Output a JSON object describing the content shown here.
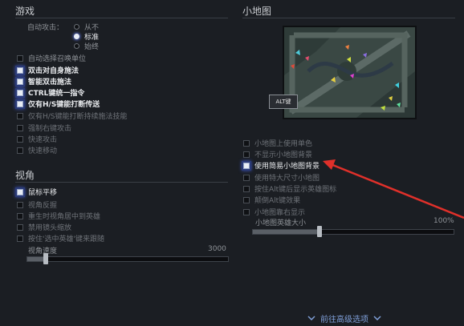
{
  "game": {
    "title": "游戏",
    "autoattack_label": "自动攻击：",
    "autoattack_options": [
      {
        "label": "从不",
        "selected": false
      },
      {
        "label": "标准",
        "selected": true
      },
      {
        "label": "始终",
        "selected": false
      }
    ],
    "options": [
      {
        "label": "自动选择召唤单位",
        "checked": false
      },
      {
        "label": "双击对自身施法",
        "checked": true
      },
      {
        "label": "智能双击施法",
        "checked": true
      },
      {
        "label": "CTRL键统一指令",
        "checked": true
      },
      {
        "label": "仅有H/S键能打断传送",
        "checked": true
      },
      {
        "label": "仅有H/S键能打断持续施法技能",
        "checked": false
      },
      {
        "label": "强制右键攻击",
        "checked": false
      },
      {
        "label": "快速攻击",
        "checked": false
      },
      {
        "label": "快速移动",
        "checked": false
      }
    ]
  },
  "camera": {
    "title": "视角",
    "options": [
      {
        "label": "鼠标平移",
        "checked": true
      },
      {
        "label": "视角反握",
        "checked": false
      },
      {
        "label": "重生时视角居中到英雄",
        "checked": false
      },
      {
        "label": "禁用镜头缩放",
        "checked": false
      },
      {
        "label": "按住'选中英雄'键来跟随",
        "checked": false
      }
    ],
    "speed_label": "视角速度",
    "speed_value": "3000",
    "speed_fraction": 0.09
  },
  "minimap": {
    "title": "小地图",
    "alt_key_label": "ALT键",
    "options": [
      {
        "label": "小地图上使用单色",
        "checked": false
      },
      {
        "label": "不显示小地图背景",
        "checked": false
      },
      {
        "label": "使用简易小地图背景",
        "checked": true
      },
      {
        "label": "使用特大尺寸小地图",
        "checked": false
      },
      {
        "label": "按住Alt键后显示英雄图标",
        "checked": false
      },
      {
        "label": "颠倒Alt键效果",
        "checked": false
      },
      {
        "label": "小地图靠右显示",
        "checked": false
      }
    ],
    "hero_size_label": "小地图英雄大小",
    "hero_size_value": "100%",
    "hero_size_fraction": 0.33
  },
  "footer": {
    "advanced_label": "前往高级选项"
  },
  "colors": {
    "background": "#1b1e23",
    "check_glow": "#3c52b8",
    "arrow": "#e0302a",
    "link": "#7f9fd8"
  }
}
